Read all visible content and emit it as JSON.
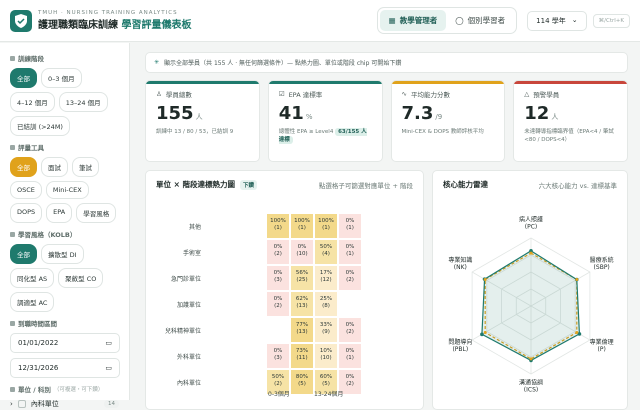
{
  "header": {
    "subtitle": "TMUH · NURSING TRAINING ANALYTICS",
    "title_main": "護理職類臨床訓練",
    "title_accent": "學習評量儀表板",
    "role_admin": "教學管理者",
    "role_learner": "個別學習者",
    "year": "114 學年",
    "shortcut": "⌘/Ctrl+K"
  },
  "sidebar": {
    "training_stage_label": "訓練階段",
    "stages": [
      "全部",
      "0–3 個月",
      "4–12 個月",
      "13–24 個月",
      "已結訓 (>24M)"
    ],
    "tools_label": "評量工具",
    "tools": [
      "全部",
      "面試",
      "筆試",
      "OSCE",
      "Mini-CEX",
      "DOPS",
      "EPA",
      "學習風格"
    ],
    "kolb_label": "學習風格（KOLB）",
    "kolb": [
      "全部",
      "擴散型 DI",
      "同化型 AS",
      "聚斂型 CO",
      "調適型 AC"
    ],
    "date_label": "到職時間區間",
    "date_from": "01/01/2022",
    "date_to": "12/31/2026",
    "unit_label": "單位 / 科別",
    "unit_hint": "（可複選・可下鑽）",
    "unit_item": "內科單位",
    "unit_count": "14"
  },
  "banner": {
    "text": "顯示全部學員（共 155 人 · 無任何篩選條件）— 點熱力圖、單位或階段 chip 可開始下鑽"
  },
  "kpis": [
    {
      "label": "學員總數",
      "value": "155",
      "unit": "人",
      "sub": "訓練中 13 / 80 / 53，已結訓 9",
      "color": "#1f7a6d"
    },
    {
      "label": "EPA 達標率",
      "value": "41",
      "unit": "%",
      "sub": "總體性 EPA ≥ Level4",
      "pill": "63/155 人達標",
      "color": "#1f7a6d"
    },
    {
      "label": "平均能力分數",
      "value": "7.3",
      "unit": "/9",
      "sub": "Mini-CEX & DOPS 教師評核平均",
      "color": "#e0a21b"
    },
    {
      "label": "預警學員",
      "value": "12",
      "unit": "人",
      "sub": "未達轉導指標臨界值（EPA<4 / 筆試<80 / DOPS<4）",
      "color": "#c8463b"
    }
  ],
  "heatmap": {
    "title": "單位 × 階段達標熱力圖",
    "tag": "下鑽",
    "hint": "點選格子可篩選對應單位 + 階段",
    "rows": [
      "其他",
      "手術室",
      "急門診單位",
      "加護單位",
      "兒科精神單位",
      "外科單位",
      "內科單位"
    ],
    "x_labels": [
      "0-3個月",
      "13-24個月"
    ],
    "cells": [
      [
        "100%\n(1)",
        "100%\n(1)",
        "100%\n(1)",
        "0%\n(1)"
      ],
      [
        "0%\n(2)",
        "0%\n(10)",
        "50%\n(4)",
        "0%\n(1)"
      ],
      [
        "0%\n(3)",
        "56%\n(25)",
        "17%\n(12)",
        "0%\n(2)"
      ],
      [
        "0%\n(2)",
        "62%\n(13)",
        "25%\n(8)",
        ""
      ],
      [
        "",
        "77%\n(13)",
        "33%\n(9)",
        "0%\n(2)"
      ],
      [
        "0%\n(3)",
        "73%\n(11)",
        "10%\n(10)",
        "0%\n(1)"
      ],
      [
        "50%\n(2)",
        "80%\n(5)",
        "60%\n(5)",
        "0%\n(2)"
      ]
    ],
    "values": [
      [
        100,
        100,
        100,
        0
      ],
      [
        0,
        0,
        50,
        0
      ],
      [
        0,
        56,
        17,
        0
      ],
      [
        0,
        62,
        25,
        null
      ],
      [
        null,
        77,
        33,
        0
      ],
      [
        0,
        73,
        10,
        0
      ],
      [
        50,
        80,
        60,
        0
      ]
    ]
  },
  "radar": {
    "title": "核心能力雷達",
    "hint": "六大核心能力 vs. 達標基準",
    "axes": [
      "病人照護\n(PC)",
      "醫療系統\n(SBP)",
      "專業倫理\n(P)",
      "溝通協調\n(ICS)",
      "問題導向\n(PBL)",
      "專業知識\n(NK)"
    ],
    "learner": [
      7.3,
      7.0,
      7.4,
      7.2,
      7.5,
      7.1
    ],
    "benchmark": [
      7.0,
      7.0,
      7.0,
      7.0,
      7.0,
      7.0
    ],
    "max": 9
  }
}
